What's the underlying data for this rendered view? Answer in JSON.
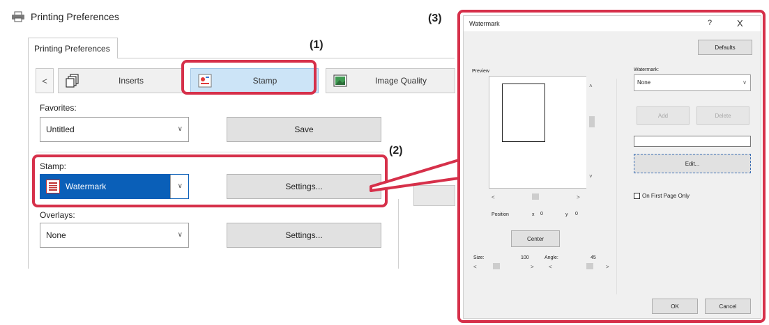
{
  "window": {
    "title": "Printing Preferences",
    "tab": "Printing Preferences"
  },
  "nav": {
    "prev": "<",
    "items": [
      {
        "label": "Inserts",
        "icon": "inserts-icon"
      },
      {
        "label": "Stamp",
        "icon": "stamp-icon",
        "active": true
      },
      {
        "label": "Image Quality",
        "icon": "image-quality-icon"
      }
    ]
  },
  "favorites": {
    "label": "Favorites:",
    "value": "Untitled",
    "save": "Save"
  },
  "stamp": {
    "label": "Stamp:",
    "value": "Watermark",
    "settings": "Settings..."
  },
  "overlays": {
    "label": "Overlays:",
    "value": "None",
    "settings": "Settings..."
  },
  "callouts": {
    "one": "(1)",
    "two": "(2)",
    "three": "(3)",
    "color": "#d6304a"
  },
  "watermark_dialog": {
    "title": "Watermark",
    "help": "?",
    "close": "X",
    "defaults": "Defaults",
    "preview_label": "Preview",
    "position_label": "Position",
    "pos_x_label": "x",
    "pos_x": "0",
    "pos_y_label": "y",
    "pos_y": "0",
    "center": "Center",
    "size_label": "Size:",
    "size_value": "100",
    "angle_label": "Angle:",
    "angle_value": "45",
    "watermark_label": "Watermark:",
    "watermark_value": "None",
    "add": "Add",
    "delete": "Delete",
    "edit": "Edit...",
    "first_page_only": "On First Page Only",
    "ok": "OK",
    "cancel": "Cancel"
  }
}
